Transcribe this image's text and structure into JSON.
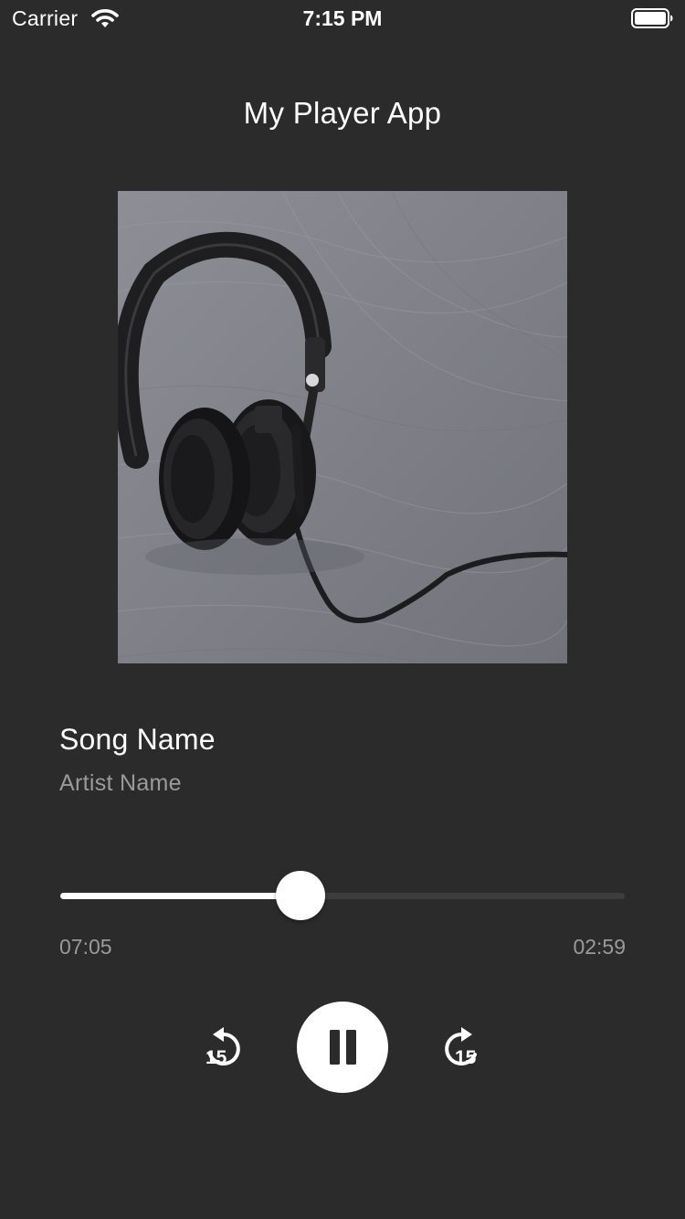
{
  "status_bar": {
    "carrier": "Carrier",
    "time": "7:15 PM",
    "wifi_icon": "wifi-icon",
    "battery_icon": "battery-icon"
  },
  "header": {
    "title": "My Player App"
  },
  "album": {
    "art": "headphones-photo"
  },
  "track": {
    "song_name": "Song Name",
    "artist_name": "Artist Name"
  },
  "progress": {
    "fraction": 0.425,
    "elapsed": "07:05",
    "remaining": "02:59"
  },
  "controls": {
    "rewind_icon": "rewind-15-icon",
    "play_pause_icon": "pause-icon",
    "forward_icon": "forward-15-icon",
    "skip_seconds": "15"
  },
  "colors": {
    "background": "#2b2b2b",
    "primary_text": "#ffffff",
    "secondary_text": "#9a9a9a",
    "track_inactive": "#3d3d3d",
    "track_active": "#ffffff"
  }
}
